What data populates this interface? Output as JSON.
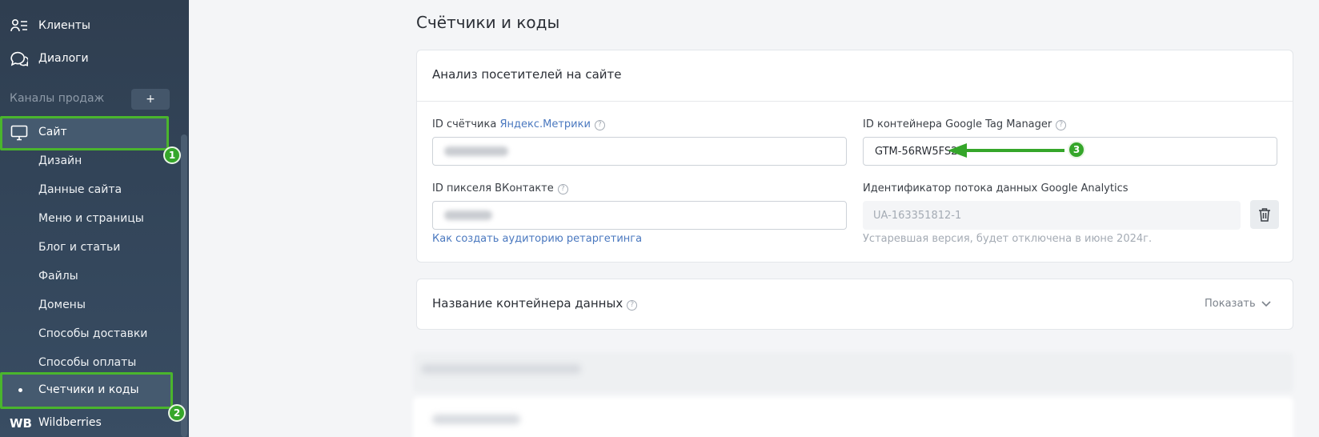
{
  "sidebar": {
    "items": [
      {
        "label": "Клиенты",
        "icon": "clients-icon"
      },
      {
        "label": "Диалоги",
        "icon": "chat-icon"
      }
    ],
    "section_label": "Каналы продаж",
    "add_label": "+",
    "site": {
      "label": "Сайт",
      "icon": "monitor-icon"
    },
    "subitems": [
      "Дизайн",
      "Данные сайта",
      "Меню и страницы",
      "Блог и статьи",
      "Файлы",
      "Домены",
      "Способы доставки",
      "Способы оплаты"
    ],
    "active_subitem": "Счетчики и коды",
    "wb_logo": "WB",
    "wb_label": "Wildberries"
  },
  "annotations": {
    "badge1": "1",
    "badge2": "2",
    "badge3": "3",
    "color": "#4ab52d"
  },
  "main": {
    "title": "Счётчики и коды",
    "card": {
      "heading": "Анализ посетителей на сайте",
      "yandex_label_prefix": "ID счётчика ",
      "yandex_label_link": "Яндекс.Метрики",
      "gtm_label": "ID контейнера Google Tag Manager",
      "gtm_value": "GTM-56RW5FS2",
      "vk_label": "ID пикселя ВКонтакте",
      "vk_link": "Как создать аудиторию ретаргетинга",
      "ga_label": "Идентификатор потока данных Google Analytics",
      "ga_placeholder": "UA-163351812-1",
      "ga_hint": "Устаревшая версия, будет отключена в июне 2024г.",
      "help": "?"
    },
    "container_card": {
      "title": "Название контейнера данных",
      "show_label": "Показать"
    }
  }
}
